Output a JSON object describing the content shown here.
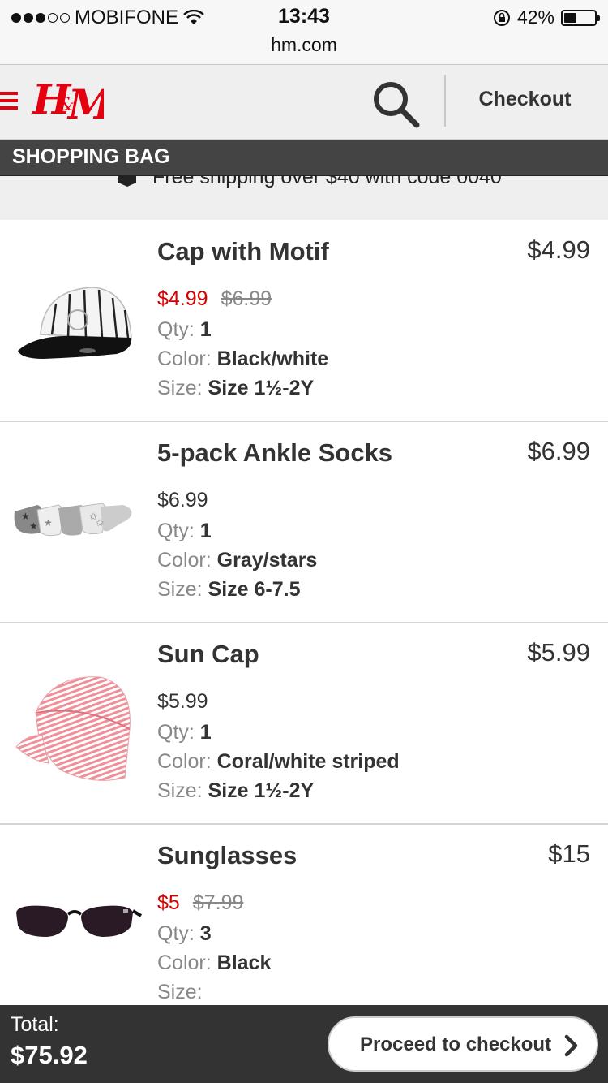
{
  "status_bar": {
    "carrier": "MOBIFONE",
    "time": "13:43",
    "url": "hm.com",
    "battery": "42%",
    "battery_level": 0.42
  },
  "header": {
    "logo_text": "H&M",
    "checkout_label": "Checkout",
    "brand_color": "#e50010"
  },
  "bag_title": "SHOPPING BAG",
  "promo": "Free shipping over $40 with code 0040",
  "labels": {
    "qty": "Qty:",
    "color": "Color:",
    "size": "Size:"
  },
  "items": [
    {
      "name": "Cap with Motif",
      "line_total": "$4.99",
      "price": "$4.99",
      "old_price": "$6.99",
      "on_sale": true,
      "qty": "1",
      "color": "Black/white",
      "size": "Size 1½-2Y"
    },
    {
      "name": "5-pack Ankle Socks",
      "line_total": "$6.99",
      "price": "$6.99",
      "old_price": "",
      "on_sale": false,
      "qty": "1",
      "color": "Gray/stars",
      "size": "Size 6-7.5"
    },
    {
      "name": "Sun Cap",
      "line_total": "$5.99",
      "price": "$5.99",
      "old_price": "",
      "on_sale": false,
      "qty": "1",
      "color": "Coral/white striped",
      "size": "Size 1½-2Y"
    },
    {
      "name": "Sunglasses",
      "line_total": "$15",
      "price": "$5",
      "old_price": "$7.99",
      "on_sale": true,
      "qty": "3",
      "color": "Black",
      "size": ""
    }
  ],
  "footer": {
    "total_label": "Total:",
    "total_value": "$75.92",
    "proceed_label": "Proceed to checkout"
  }
}
